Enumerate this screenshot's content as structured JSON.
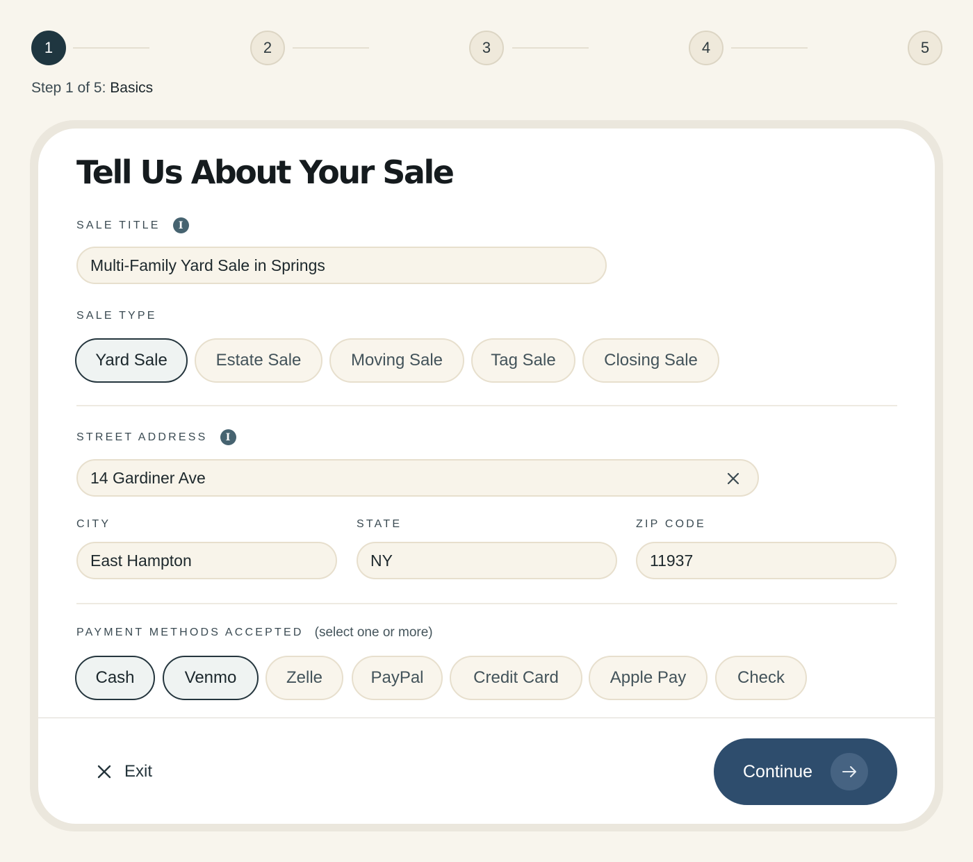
{
  "stepper": {
    "steps": [
      {
        "number": "1",
        "active": true
      },
      {
        "number": "2",
        "active": false
      },
      {
        "number": "3",
        "active": false
      },
      {
        "number": "4",
        "active": false
      },
      {
        "number": "5",
        "active": false
      }
    ],
    "caption_prefix": "Step 1 of 5:",
    "caption_step_name": "Basics"
  },
  "form": {
    "title": "Tell Us About Your Sale",
    "sale_title": {
      "label": "SALE TITLE",
      "value": "Multi-Family Yard Sale in Springs"
    },
    "sale_type": {
      "label": "SALE TYPE",
      "options": [
        "Yard Sale",
        "Estate Sale",
        "Moving Sale",
        "Tag Sale",
        "Closing Sale"
      ],
      "selected": "Yard Sale"
    },
    "street_address": {
      "label": "STREET ADDRESS",
      "value": "14 Gardiner Ave"
    },
    "city": {
      "label": "CITY",
      "value": "East Hampton"
    },
    "state": {
      "label": "STATE",
      "value": "NY"
    },
    "zip": {
      "label": "ZIP CODE",
      "value": "11937"
    },
    "payment": {
      "label": "PAYMENT METHODS ACCEPTED",
      "hint": "(select one or more)",
      "options": [
        "Cash",
        "Venmo",
        "Zelle",
        "PayPal",
        "Credit Card",
        "Apple Pay",
        "Check"
      ],
      "selected": [
        "Cash",
        "Venmo"
      ]
    }
  },
  "footer": {
    "exit_label": "Exit",
    "continue_label": "Continue"
  },
  "icons": {
    "info": "info-icon",
    "clear": "close-icon",
    "exit": "close-icon",
    "continue": "arrow-right-icon"
  },
  "colors": {
    "page_background": "#f8f5ed",
    "active_step": "#1f3640",
    "primary_button": "#2e4d6d",
    "selected_chip_border": "#24353d",
    "input_background": "#f8f4ea"
  }
}
